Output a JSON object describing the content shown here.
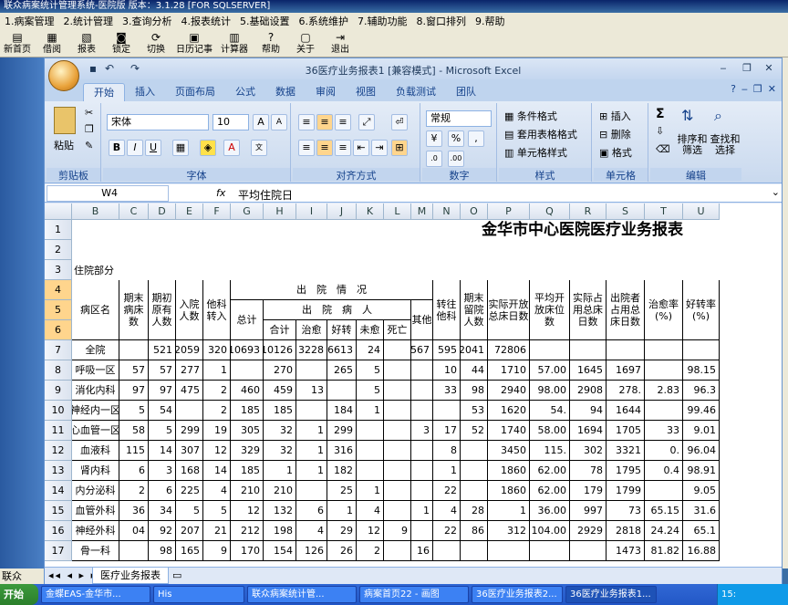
{
  "outer": {
    "title": "联众病案统计管理系统-医院版   版本：3.1.28 [FOR SQLSERVER]",
    "menu": [
      "1.病案管理",
      "2.统计管理",
      "3.查询分析",
      "4.报表统计",
      "5.基础设置",
      "6.系统维护",
      "7.辅助功能",
      "8.窗口排列",
      "9.帮助"
    ],
    "toolbar": [
      {
        "label": "新首页",
        "icon": "new-page-icon",
        "glyph": "▤"
      },
      {
        "label": "借阅",
        "icon": "borrow-icon",
        "glyph": "▦"
      },
      {
        "label": "报表",
        "icon": "report-icon",
        "glyph": "🖶"
      },
      {
        "label": "锁定",
        "icon": "lock-icon",
        "glyph": "🔒"
      },
      {
        "label": "切换",
        "icon": "switch-icon",
        "glyph": "⟳"
      },
      {
        "label": "日历记事",
        "icon": "calendar-icon",
        "glyph": "▣"
      },
      {
        "label": "计算器",
        "icon": "calculator-icon",
        "glyph": "▥"
      },
      {
        "label": "帮助",
        "icon": "help-icon",
        "glyph": "?"
      },
      {
        "label": "关于",
        "icon": "about-icon",
        "glyph": "▢"
      },
      {
        "label": "退出",
        "icon": "exit-icon",
        "glyph": "⇥"
      }
    ],
    "status_left": "联众"
  },
  "excel": {
    "title": "36医疗业务报表1  [兼容模式] - Microsoft Excel",
    "tabs": [
      "开始",
      "插入",
      "页面布局",
      "公式",
      "数据",
      "审阅",
      "视图",
      "负载测试",
      "团队"
    ],
    "active_tab": "开始",
    "groups": {
      "clipboard": "剪贴板",
      "font": "字体",
      "align": "对齐方式",
      "number": "数字",
      "styles": "样式",
      "cells": "单元格",
      "editing": "编辑"
    },
    "paste": "粘贴",
    "font_name": "宋体",
    "font_size": "10",
    "number_format": "常规",
    "styles_items": [
      "条件格式",
      "套用表格格式",
      "单元格样式"
    ],
    "cells_items": [
      "插入",
      "删除",
      "格式"
    ],
    "editing_items": [
      "排序和筛选",
      "查找和选择"
    ],
    "name_box": "W4",
    "fx": "fx",
    "formula": "平均住院日",
    "sheet_tab": "医疗业务报表"
  },
  "sheet": {
    "columns": [
      "B",
      "C",
      "D",
      "E",
      "F",
      "G",
      "H",
      "I",
      "J",
      "K",
      "L",
      "M",
      "N",
      "O",
      "P",
      "Q",
      "R",
      "S",
      "T",
      "U"
    ],
    "rows": [
      "1",
      "2",
      "3",
      "4",
      "5",
      "6",
      "7",
      "8",
      "9",
      "10",
      "11",
      "12",
      "13",
      "14",
      "15",
      "16",
      "17"
    ],
    "title": "金华市中心医院医疗业务报表",
    "section": "住院部分",
    "headers": {
      "dept": "病区名",
      "start": "期末病床数",
      "orig": "期初原有人数",
      "admit": "入院人数",
      "transin": "他科转入",
      "discharge": "出　院　情　况",
      "total": "总计",
      "patients": "出　院　病　人",
      "sum": "合计",
      "cured": "治愈",
      "better": "好转",
      "notcured": "未愈",
      "dead": "死亡",
      "other": "其他",
      "transout": "转往他科",
      "remain": "期末留院人数",
      "bedday": "实际开放总床日数",
      "avgbed": "平均开放床位数",
      "occ": "实际占用总床日数",
      "outocc": "出院者占用总床日数",
      "cure_rate": "治愈率(%)",
      "better_rate": "好转率(%)"
    },
    "data_rows": [
      {
        "dept": "全院",
        "c": [
          "",
          "521",
          "2059",
          "320",
          "10693",
          "10126",
          "3228",
          "6613",
          "24",
          "",
          "567",
          "595",
          "2041",
          "72806",
          "",
          "",
          "",
          "",
          "",
          ""
        ]
      },
      {
        "dept": "呼吸一区",
        "c": [
          "57",
          "57",
          "277",
          "1",
          "",
          "270",
          "",
          "265",
          "5",
          "",
          "",
          "10",
          "44",
          "1710",
          "57.00",
          "1645",
          "1697",
          "",
          "98.15"
        ]
      },
      {
        "dept": "消化内科",
        "c": [
          "97",
          "97",
          "475",
          "2",
          "460",
          "459",
          "13",
          "",
          "5",
          "",
          "",
          "33",
          "98",
          "2940",
          "98.00",
          "2908",
          "278.",
          "2.83",
          "96.3"
        ]
      },
      {
        "dept": "神经内一区",
        "c": [
          "5",
          "54",
          "",
          "2",
          "185",
          "185",
          "",
          "184",
          "1",
          "",
          "",
          "",
          "53",
          "1620",
          "54.",
          "94",
          "1644",
          "",
          "99.46"
        ]
      },
      {
        "dept": "心血管一区",
        "c": [
          "58",
          "5",
          "299",
          "19",
          "305",
          "32",
          "1",
          "299",
          "",
          "",
          "3",
          "17",
          "52",
          "1740",
          "58.00",
          "1694",
          "1705",
          "33",
          "9.01"
        ]
      },
      {
        "dept": "血液科",
        "c": [
          "115",
          "14",
          "307",
          "12",
          "329",
          "32",
          "1",
          "316",
          "",
          "",
          "",
          "8",
          "",
          "3450",
          "115.",
          "302",
          "3321",
          "0.",
          "96.04"
        ]
      },
      {
        "dept": "肾内科",
        "c": [
          "6",
          "3",
          "168",
          "14",
          "185",
          "1",
          "1",
          "182",
          "",
          "",
          "",
          "1",
          "",
          "1860",
          "62.00",
          "78",
          "1795",
          "0.4",
          "98.91"
        ]
      },
      {
        "dept": "内分泌科",
        "c": [
          "2",
          "6",
          "225",
          "4",
          "210",
          "210",
          "",
          "25",
          "1",
          "",
          "",
          "22",
          "",
          "1860",
          "62.00",
          "179",
          "1799",
          "",
          "9.05"
        ]
      },
      {
        "dept": "血管外科",
        "c": [
          "36",
          "34",
          "5",
          "5",
          "12",
          "132",
          "6",
          "1",
          "4",
          "",
          "1",
          "4",
          "28",
          "1",
          "36.00",
          "997",
          "73",
          "65.15",
          "31.6"
        ]
      },
      {
        "dept": "神经外科",
        "c": [
          "04",
          "92",
          "207",
          "21",
          "212",
          "198",
          "4",
          "29",
          "12",
          "9",
          "",
          "22",
          "86",
          "312",
          "104.00",
          "2929",
          "2818",
          "24.24",
          "65.1"
        ]
      },
      {
        "dept": "骨一科",
        "c": [
          "",
          "98",
          "165",
          "9",
          "170",
          "154",
          "126",
          "26",
          "2",
          "",
          "16",
          "",
          "",
          "",
          "",
          "",
          "1473",
          "81.82",
          "16.88"
        ]
      }
    ]
  },
  "taskbar": {
    "start": "开始",
    "items": [
      "金蝶EAS-金华市...",
      "His",
      "联众病案统计管...",
      "病案首页22 - 画图",
      "36医疗业务报表2...",
      "36医疗业务报表1..."
    ],
    "clock": "15:"
  },
  "colors": {
    "ribbon": "#dfe8f6",
    "accent": "#15428b",
    "selected_row": "#ffd58d"
  }
}
